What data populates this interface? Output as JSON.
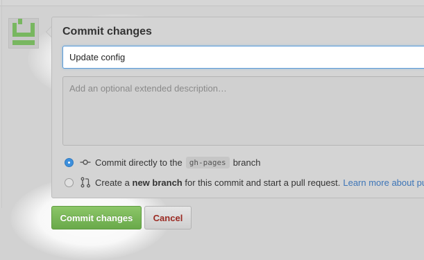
{
  "commit_form": {
    "title": "Commit changes",
    "summary_value": "Update config",
    "description_placeholder": "Add an optional extended description…",
    "options": {
      "direct": {
        "prefix": "Commit directly to the",
        "branch_name": "gh-pages",
        "suffix": "branch",
        "checked": true
      },
      "new_branch": {
        "prefix": "Create a",
        "bold": "new branch",
        "suffix": "for this commit and start a pull request.",
        "link": "Learn more about pu",
        "checked": false
      }
    },
    "buttons": {
      "commit_label": "Commit changes",
      "cancel_label": "Cancel"
    }
  },
  "icons": {
    "avatar": "user-identicon",
    "commit": "git-commit-icon",
    "pull_request": "git-pull-request-icon"
  },
  "colors": {
    "commit_button": "#6fb04f",
    "cancel_text": "#9b2a22",
    "link": "#3d75b7",
    "radio_checked": "#3d8fdc",
    "focus_border": "#5a9ad8"
  }
}
